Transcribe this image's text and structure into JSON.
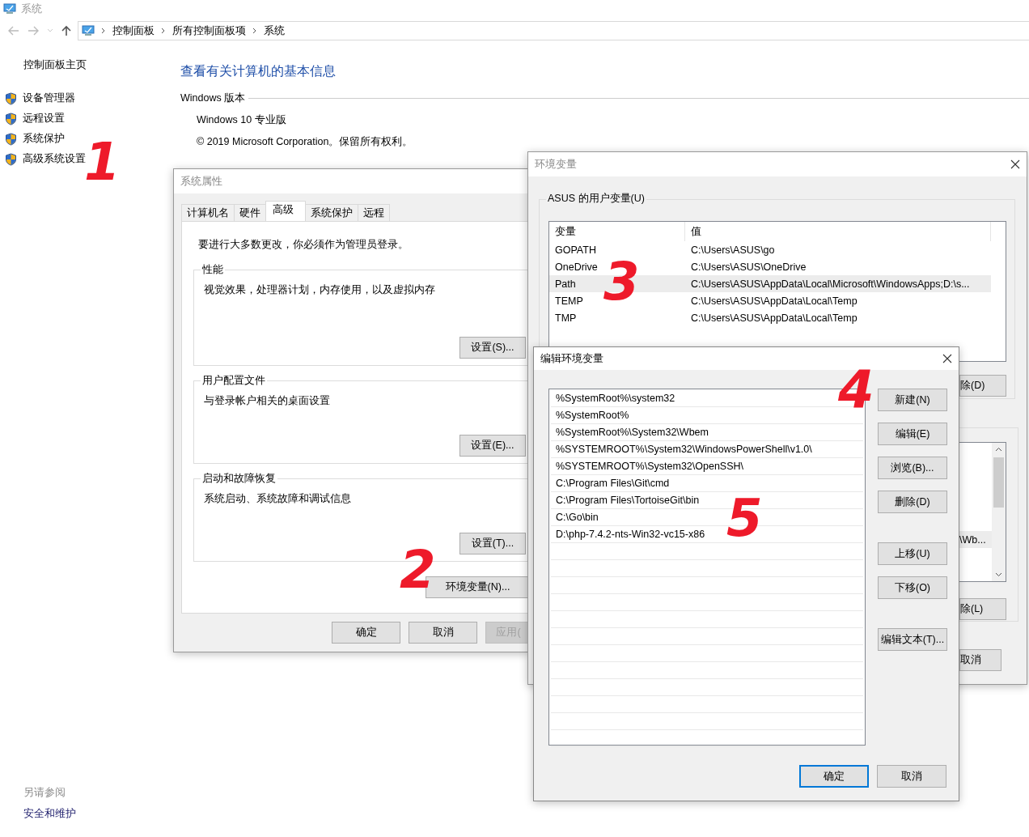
{
  "window": {
    "title": "系统"
  },
  "breadcrumb": [
    "控制面板",
    "所有控制面板项",
    "系统"
  ],
  "sidebar": {
    "home": "控制面板主页",
    "links": [
      "设备管理器",
      "远程设置",
      "系统保护",
      "高级系统设置"
    ],
    "see_also": {
      "heading": "另请参阅",
      "links": [
        "安全和维护"
      ]
    }
  },
  "main": {
    "heading": "查看有关计算机的基本信息",
    "section": "Windows 版本",
    "lines": [
      "Windows 10 专业版",
      "© 2019 Microsoft Corporation。保留所有权利。"
    ]
  },
  "system_properties": {
    "title": "系统属性",
    "tabs": [
      {
        "label": "计算机名",
        "selected": false
      },
      {
        "label": "硬件",
        "selected": false
      },
      {
        "label": "高级",
        "selected": true
      },
      {
        "label": "系统保护",
        "selected": false
      },
      {
        "label": "远程",
        "selected": false
      }
    ],
    "notice": "要进行大多数更改，你必须作为管理员登录。",
    "groups": [
      {
        "title": "性能",
        "description": "视觉效果，处理器计划，内存使用，以及虚拟内存",
        "button": "设置(S)..."
      },
      {
        "title": "用户配置文件",
        "description": "与登录帐户相关的桌面设置",
        "button": "设置(E)..."
      },
      {
        "title": "启动和故障恢复",
        "description": "系统启动、系统故障和调试信息",
        "button": "设置(T)..."
      }
    ],
    "env_button": "环境变量(N)...",
    "buttons": [
      {
        "label": "确定",
        "disabled": false
      },
      {
        "label": "取消",
        "disabled": false
      },
      {
        "label": "应用(",
        "disabled": true
      }
    ]
  },
  "environment_variables": {
    "title": "环境变量",
    "user_group": "ASUS 的用户变量(U)",
    "columns": [
      "变量",
      "值"
    ],
    "rows": [
      {
        "name": "GOPATH",
        "value": "C:\\Users\\ASUS\\go",
        "selected": false
      },
      {
        "name": "OneDrive",
        "value": "C:\\Users\\ASUS\\OneDrive",
        "selected": false
      },
      {
        "name": "Path",
        "value": "C:\\Users\\ASUS\\AppData\\Local\\Microsoft\\WindowsApps;D:\\s...",
        "selected": true
      },
      {
        "name": "TEMP",
        "value": "C:\\Users\\ASUS\\AppData\\Local\\Temp",
        "selected": false
      },
      {
        "name": "TMP",
        "value": "C:\\Users\\ASUS\\AppData\\Local\\Temp",
        "selected": false
      }
    ],
    "user_delete_button": "除(D)",
    "system_row_fragment": "\\Wb...",
    "system_delete_button": "除(L)",
    "cancel_button": "取消"
  },
  "edit_dialog": {
    "title": "编辑环境变量",
    "entries": [
      "%SystemRoot%\\system32",
      "%SystemRoot%",
      "%SystemRoot%\\System32\\Wbem",
      "%SYSTEMROOT%\\System32\\WindowsPowerShell\\v1.0\\",
      "%SYSTEMROOT%\\System32\\OpenSSH\\",
      "C:\\Program Files\\Git\\cmd",
      "C:\\Program Files\\TortoiseGit\\bin",
      "C:\\Go\\bin",
      "D:\\php-7.4.2-nts-Win32-vc15-x86"
    ],
    "buttons": [
      "新建(N)",
      "编辑(E)",
      "浏览(B)...",
      "删除(D)",
      "上移(U)",
      "下移(O)",
      "编辑文本(T)..."
    ],
    "ok": "确定",
    "cancel": "取消"
  },
  "annotations": [
    "1",
    "2",
    "3",
    "4",
    "5"
  ]
}
